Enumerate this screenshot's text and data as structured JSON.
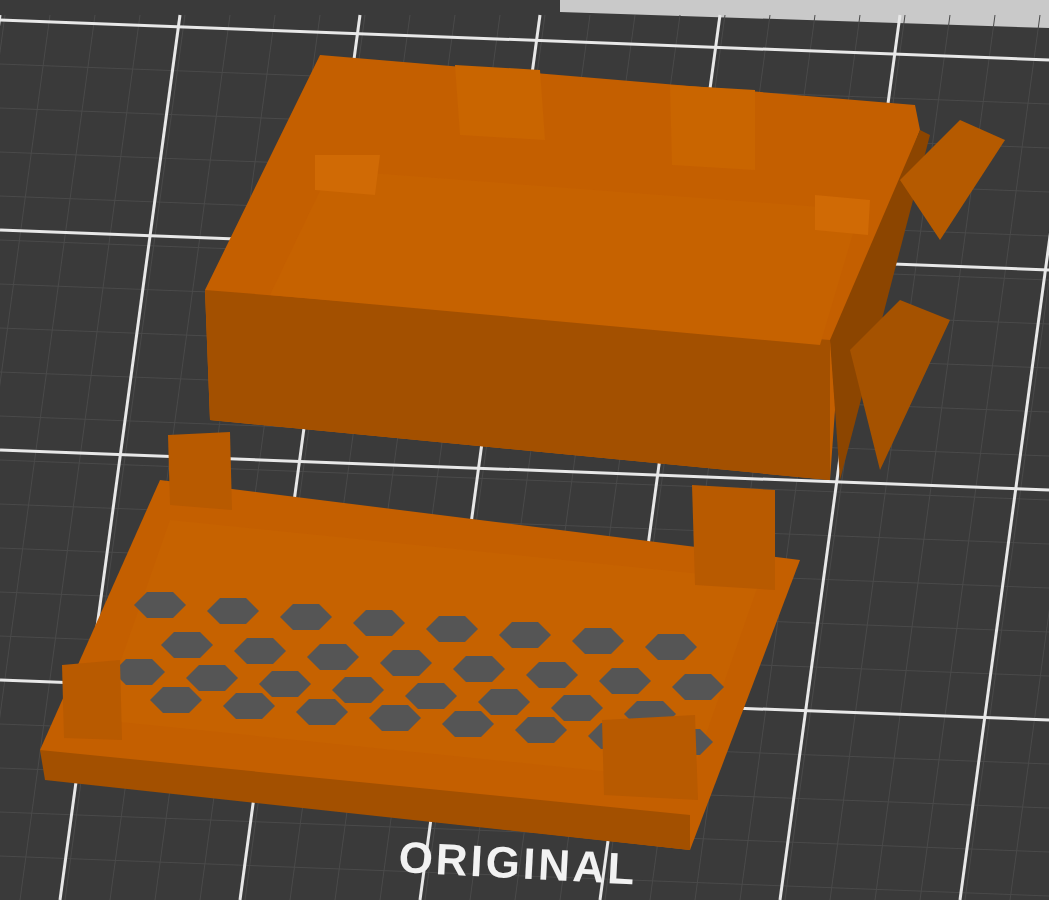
{
  "viewport": {
    "bed_label": "ORIGINAL"
  }
}
